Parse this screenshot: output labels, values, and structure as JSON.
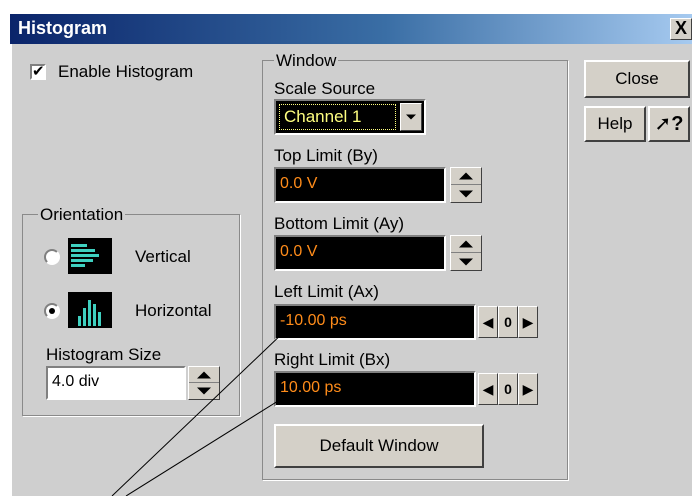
{
  "window": {
    "title": "Histogram",
    "close_glyph": "X"
  },
  "enable_histogram": {
    "label": "Enable Histogram",
    "checked": true
  },
  "orientation": {
    "group_label": "Orientation",
    "vertical_label": "Vertical",
    "horizontal_label": "Horizontal",
    "selected": "Horizontal",
    "size_label": "Histogram Size",
    "size_value": "4.0 div"
  },
  "window_group": {
    "group_label": "Window",
    "scale_source_label": "Scale Source",
    "scale_source_value": "Channel 1",
    "top_limit_label": "Top Limit (By)",
    "top_limit_value": "0.0 V",
    "bottom_limit_label": "Bottom Limit (Ay)",
    "bottom_limit_value": "0.0 V",
    "left_limit_label": "Left Limit (Ax)",
    "left_limit_value": "-10.00 ps",
    "right_limit_label": "Right Limit (Bx)",
    "right_limit_value": "10.00 ps",
    "zero_label": "0",
    "default_window_label": "Default Window"
  },
  "buttons": {
    "close_label": "Close",
    "help_label": "Help",
    "whats_this_glyph": "?"
  },
  "colors": {
    "field_text": "#ff8c1a",
    "combo_text": "#ffff80",
    "dialog_bg": "#cfcfcf",
    "title_start": "#0a246a",
    "title_end": "#a6caf0"
  },
  "icons": {
    "vertical": "vertical-histogram-icon",
    "horizontal": "horizontal-histogram-icon",
    "whats_this": "help-cursor-icon"
  }
}
